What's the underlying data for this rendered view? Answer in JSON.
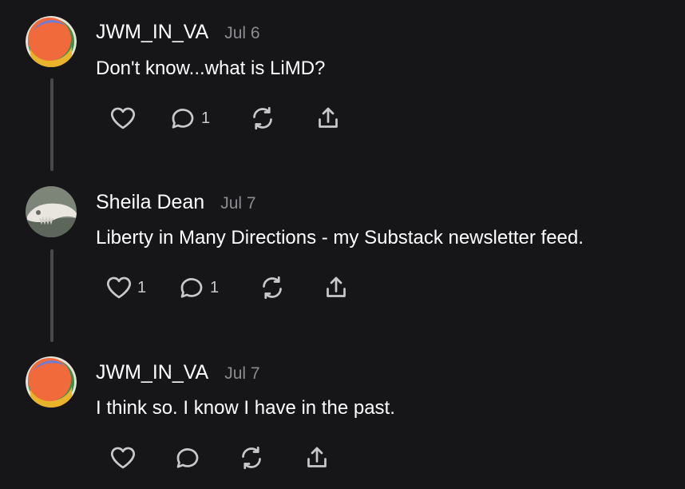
{
  "comments": [
    {
      "author": "JWM_IN_VA",
      "date": "Jul 6",
      "text": "Don't know...what is LiMD?",
      "avatar": "orange-circle-avatar",
      "likes": "",
      "replies": "1"
    },
    {
      "author": "Sheila Dean",
      "date": "Jul 7",
      "text": "Liberty in Many Directions - my Substack newsletter feed.",
      "avatar": "bird-skull-photo-avatar",
      "likes": "1",
      "replies": "1"
    },
    {
      "author": "JWM_IN_VA",
      "date": "Jul 7",
      "text": "I think so. I know I have in the past.",
      "avatar": "orange-circle-avatar",
      "likes": "",
      "replies": ""
    }
  ],
  "icons": {
    "like": "heart-icon",
    "reply": "comment-bubble-icon",
    "restack": "restack-icon",
    "share": "share-icon"
  },
  "colors": {
    "background": "#161618",
    "text": "#ffffff",
    "muted": "#8c8c90",
    "icon": "#c9c9cc",
    "avatar_orange": "#f06a3c"
  }
}
